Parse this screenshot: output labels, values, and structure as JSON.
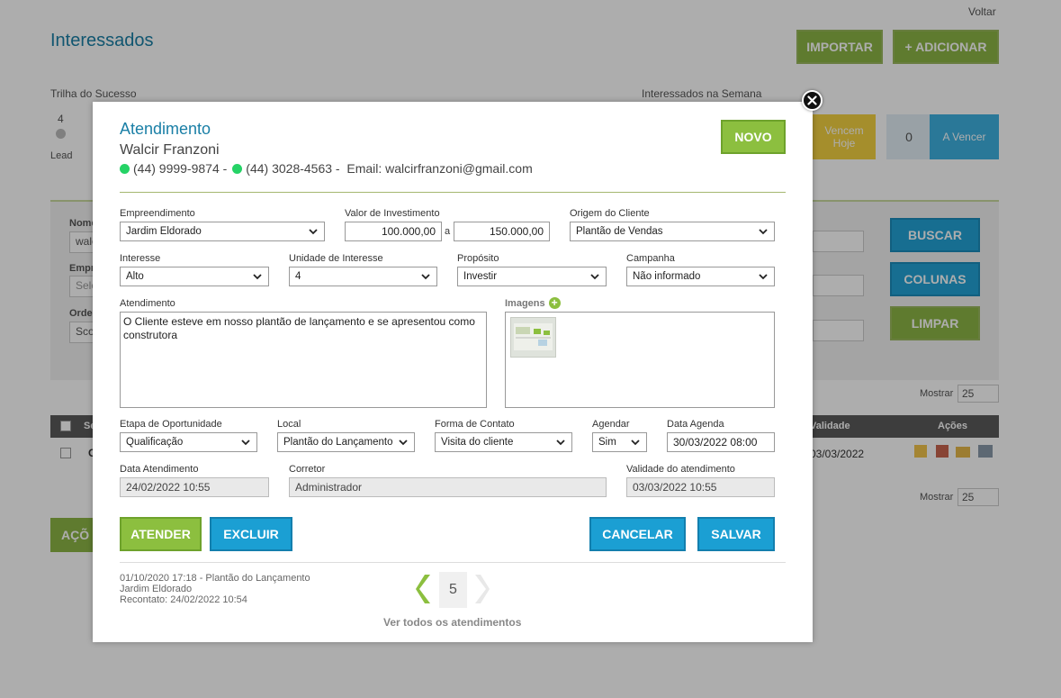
{
  "page": {
    "title": "Interessados",
    "back_link": "Voltar",
    "import_label": "IMPORTAR",
    "add_label": "+ ADICIONAR",
    "trail_title": "Trilha do Sucesso",
    "trail_value": "4",
    "trail_stage": "Lead",
    "week_title": "Interessados na Semana",
    "due_today_label": "Vencem Hoje",
    "to_expire_count": "0",
    "to_expire_label": "A Vencer",
    "filter_name_label": "Nome",
    "filter_name_value": "walc",
    "filter_emp_label": "Empr",
    "filter_emp_value": "Sele",
    "filter_order_label": "Orde",
    "filter_order_value": "Sco",
    "search_label": "BUSCAR",
    "columns_label": "COLUNAS",
    "clear_label": "LIMPAR",
    "show_label": "Mostrar",
    "show_value": "25",
    "col_select": "Se",
    "col_validity": "Validade",
    "col_actions": "Ações",
    "row_initial": "C",
    "row_validity": "03/03/2022",
    "actions_label": "AÇÕ"
  },
  "modal": {
    "title": "Atendimento",
    "client_name": "Walcir Franzoni",
    "phone1": "(44) 9999-9874 -",
    "phone2": "(44) 3028-4563",
    "email": " -  Email: walcirfranzoni@gmail.com",
    "new_label": "NOVO",
    "empreendimento": {
      "label": "Empreendimento",
      "value": "Jardim Eldorado"
    },
    "investimento": {
      "label": "Valor de Investimento",
      "min": "100.000,00",
      "sep": "a",
      "max": "150.000,00"
    },
    "origem": {
      "label": "Origem do Cliente",
      "value": "Plantão de Vendas"
    },
    "interesse": {
      "label": "Interesse",
      "value": "Alto"
    },
    "unidade": {
      "label": "Unidade de Interesse",
      "value": "4"
    },
    "proposito": {
      "label": "Propósito",
      "value": "Investir"
    },
    "campanha": {
      "label": "Campanha",
      "value": "Não informado"
    },
    "atendimento": {
      "label": "Atendimento",
      "text": "O Cliente esteve em nosso plantão de lançamento e se apresentou como construtora"
    },
    "imagens_label": "Imagens",
    "etapa": {
      "label": "Etapa de Oportunidade",
      "value": "Qualificação"
    },
    "local": {
      "label": "Local",
      "value": "Plantão do Lançamento"
    },
    "forma": {
      "label": "Forma de Contato",
      "value": "Visita do cliente"
    },
    "agendar": {
      "label": "Agendar",
      "value": "Sim"
    },
    "data_agenda": {
      "label": "Data Agenda",
      "value": "30/03/2022 08:00"
    },
    "data_atendimento": {
      "label": "Data Atendimento",
      "value": "24/02/2022 10:55"
    },
    "corretor": {
      "label": "Corretor",
      "value": "Administrador"
    },
    "validade": {
      "label": "Validade do atendimento",
      "value": "03/03/2022 10:55"
    },
    "atender_label": "ATENDER",
    "excluir_label": "EXCLUIR",
    "cancelar_label": "CANCELAR",
    "salvar_label": "SALVAR",
    "history_line1": "01/10/2020 17:18 - Plantão do Lançamento",
    "history_line2": "Jardim Eldorado",
    "history_line3": "Recontato: 24/02/2022 10:54",
    "page_number": "5",
    "view_all": "Ver todos os atendimentos"
  },
  "colors": {
    "green": "#8cbf3f",
    "blue": "#1b9fd3",
    "title_blue": "#1a7fa6",
    "whatsapp": "#25d366"
  }
}
